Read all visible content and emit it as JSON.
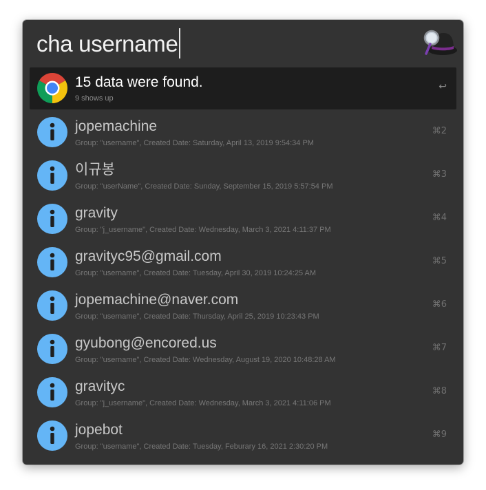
{
  "search": {
    "query": "cha username"
  },
  "header": {
    "app_icon": "alfred-hat-icon"
  },
  "results": [
    {
      "icon": "chrome-icon",
      "title": "15 data were found.",
      "subtitle": "9 shows up",
      "shortcut": "↩",
      "selected": true
    },
    {
      "icon": "info-icon",
      "title": "jopemachine",
      "subtitle": "Group: \"username\", Created Date: Saturday, April 13, 2019 9:54:34 PM",
      "shortcut": "⌘2"
    },
    {
      "icon": "info-icon",
      "title": "이규봉",
      "subtitle": "Group: \"userName\", Created Date: Sunday, September 15, 2019 5:57:54 PM",
      "shortcut": "⌘3"
    },
    {
      "icon": "info-icon",
      "title": "gravity",
      "subtitle": "Group: \"j_username\", Created Date: Wednesday, March 3, 2021 4:11:37 PM",
      "shortcut": "⌘4"
    },
    {
      "icon": "info-icon",
      "title": "gravityc95@gmail.com",
      "subtitle": "Group: \"username\", Created Date: Tuesday, April 30, 2019 10:24:25 AM",
      "shortcut": "⌘5"
    },
    {
      "icon": "info-icon",
      "title": "jopemachine@naver.com",
      "subtitle": "Group: \"username\", Created Date: Thursday, April 25, 2019 10:23:43 PM",
      "shortcut": "⌘6"
    },
    {
      "icon": "info-icon",
      "title": "gyubong@encored.us",
      "subtitle": "Group: \"username\", Created Date: Wednesday, August 19, 2020 10:48:28 AM",
      "shortcut": "⌘7"
    },
    {
      "icon": "info-icon",
      "title": "gravityc",
      "subtitle": "Group: \"j_username\", Created Date: Wednesday, March 3, 2021 4:11:06 PM",
      "shortcut": "⌘8"
    },
    {
      "icon": "info-icon",
      "title": "jopebot",
      "subtitle": "Group: \"username\", Created Date: Tuesday, Feburary 16, 2021 2:30:20 PM",
      "shortcut": "⌘9"
    }
  ],
  "colors": {
    "window_bg": "#333333",
    "selected_bg": "#1d1d1d",
    "info_icon_blue": "#64b5f6"
  }
}
